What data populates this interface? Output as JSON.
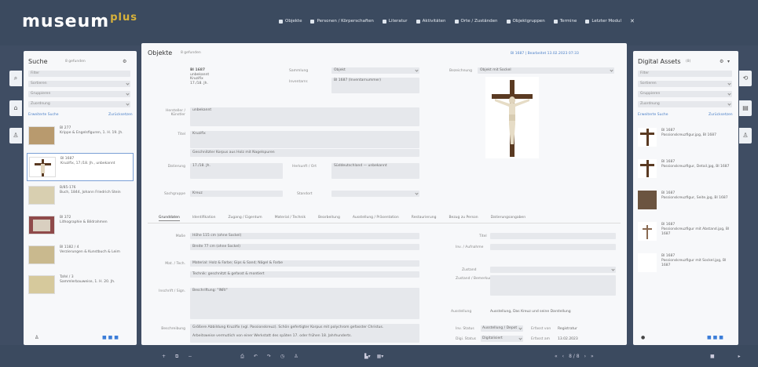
{
  "app": {
    "logo": "museum",
    "logo_plus": "plus"
  },
  "nav": {
    "items": [
      {
        "icon": "grid-icon",
        "label": "Objekte"
      },
      {
        "icon": "person-icon",
        "label": "Personen / Körperschaften"
      },
      {
        "icon": "book-icon",
        "label": "Literatur"
      },
      {
        "icon": "flag-icon",
        "label": "Aktivitäten"
      },
      {
        "icon": "pin-icon",
        "label": "Orte / Zuständen"
      },
      {
        "icon": "stack-icon",
        "label": "Objektgruppen"
      },
      {
        "icon": "calendar-icon",
        "label": "Termine"
      },
      {
        "icon": "user-icon",
        "label": "Letzter Modul"
      }
    ]
  },
  "left": {
    "title": "Suche",
    "subtitle": "8 gefunden",
    "filters": [
      "Filter",
      "Sortieren",
      "Gruppieren",
      "Zuordnung"
    ],
    "extended": "Erweiterte Suche",
    "reset": "Zurücksetzen",
    "items": [
      {
        "inv": "Bl 277",
        "text": "Krippe & Engelsfiguren, 1. H. 19. Jh."
      },
      {
        "inv": "Bl 1687",
        "text": "Kruzifix, 17./18. Jh., unbekannt"
      },
      {
        "inv": "B/85-176",
        "text": "Buch, 1844, Johann Friedrich Stein"
      },
      {
        "inv": "Bl 372",
        "text": "Lithographie & Bildrahmen"
      },
      {
        "inv": "Bl 1182 / 4",
        "text": "Verzierungen & Kunstbuch & Leim"
      },
      {
        "inv": "Tafel / 3",
        "text": "Sammlerbauweise, 1. H. 20. Jh."
      }
    ]
  },
  "center": {
    "title": "Objekte",
    "subtitle": "8 gefunden",
    "top_right": "Bl 1687 | Bearbeitet 13.02.2023 07:33",
    "header_lines": [
      "Bl 1687",
      "unbekannt",
      "Kruzifix",
      "17./18. Jh."
    ],
    "fields": {
      "sammlung_label": "Sammlung",
      "sammlung": "Objekt",
      "inventar_label": "Inventarnr.",
      "inventar": "Bl 1687 (Inventarnummer)",
      "hersteller_label": "Hersteller / Künstler",
      "hersteller": "unbekannt",
      "titel_label": "Titel",
      "titel": "Kruzifix",
      "beschreibung": "Geschnitzter Korpus aus Holz mit Nagelspuren",
      "datierung_label": "Datierung",
      "datierung": "17./18. Jh.",
      "herkunft_label": "Herkunft / Ort",
      "herkunft": "Süddeutschland — unbekannt",
      "sachgruppe_label": "Sachgruppe",
      "sachgruppe": "Kreuz",
      "standort_label": "Standort",
      "standort": "",
      "bezeichnung_label": "Bezeichnung",
      "bezeichnung": "Objekt mit Sockel"
    },
    "tabs": [
      "Grunddaten",
      "Identifikation",
      "Zugang / Eigentum",
      "Material / Technik",
      "Bearbeitung",
      "Ausstellung / Präsentation",
      "Restaurierung",
      "Bezug zu Person",
      "Datierungsangaben"
    ],
    "details": {
      "masse_label": "Maße",
      "masse": "Höhe 115 cm (ohne Sockel)",
      "masse2": "Breite 77 cm (ohne Sockel)",
      "material_label": "Mat. / Tech.",
      "material": "Material: Holz & Farbe; Gips & Sand; Nägel & Farbe",
      "technik": "Technik: geschnitzt & gefasst & montiert",
      "inschrift_label": "Inschrift / Sign.",
      "inschrift": "Beschriftung: \"INRI\"",
      "beschreibung_label": "Beschreibung",
      "beschreibung": "Größere Abbildung Kruzifix (vgl. Passionskreuz). Schön gefertigter Korpus mit polychrom gefasster Christus.",
      "beschreibung2": "Arbeitsweise vermutlich von einer Werkstatt des späten 17. oder frühen 18. Jahrhunderts.",
      "r_lbl1": "Titel",
      "r_lbl2": "Inv. / Aufnahme",
      "r_lbl3": "Zustand",
      "r_lbl4": "Zustand / Bemerkung",
      "r_lbl5": "Ausstellung",
      "r_val5": "Ausstellung, Das Kreuz und seine Darstellung",
      "r_lbl6": "Inv. Status",
      "r_val6": "Ausstellung / Depot",
      "r_lbl7": "Erfasst von",
      "r_val7": "Registratur",
      "r_lbl8": "Digi. Status",
      "r_val8": "Digitalisiert",
      "r_lbl9": "Erfasst am",
      "r_val9": "13.02.2023"
    }
  },
  "right": {
    "title": "Digital Assets",
    "count": "(8)",
    "filters": [
      "Filter",
      "Sortieren",
      "Gruppieren",
      "Zuordnung"
    ],
    "extended": "Erweiterte Suche",
    "reset": "Zurücksetzen",
    "items": [
      {
        "inv": "Bl 1687",
        "text": "Passionskreuzfigur.jpg, Bl 1687"
      },
      {
        "inv": "Bl 1687",
        "text": "Passionskreuzfigur, Detail.jpg, Bl 1687"
      },
      {
        "inv": "Bl 1687",
        "text": "Passionskreuzfigur, Seite.jpg, Bl 1687"
      },
      {
        "inv": "Bl 1687",
        "text": "Passionskreuzfigur mit Abstand.jpg, Bl 1687"
      },
      {
        "inv": "Bl 1687",
        "text": "Passionskreuzfigur mit Sockel.jpg, Bl 1687"
      }
    ]
  },
  "bottom": {
    "pager": "8 / 8"
  }
}
